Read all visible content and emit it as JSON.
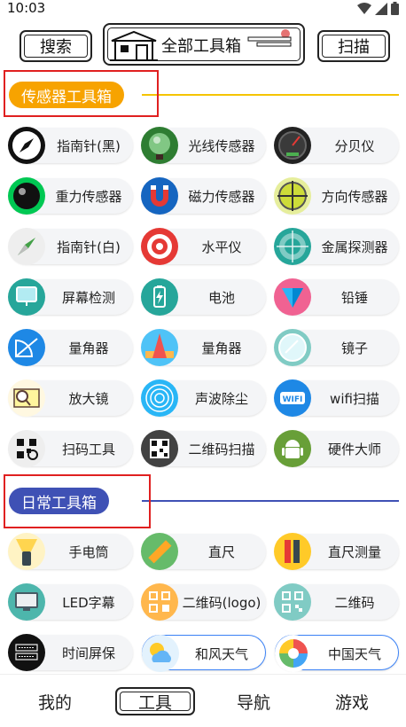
{
  "status_bar": {
    "time": "10:03"
  },
  "header": {
    "search_label": "搜索",
    "title": "全部工具箱",
    "scan_label": "扫描"
  },
  "sections": {
    "sensor": {
      "title": "传感器工具箱",
      "color": "#f7a300",
      "line_color": "#f5c400",
      "items": [
        {
          "label": "指南针(黑)",
          "icon": "compass-black-icon"
        },
        {
          "label": "光线传感器",
          "icon": "light-sensor-icon"
        },
        {
          "label": "分贝仪",
          "icon": "decibel-meter-icon"
        },
        {
          "label": "重力传感器",
          "icon": "gravity-sensor-icon"
        },
        {
          "label": "磁力传感器",
          "icon": "magnet-icon"
        },
        {
          "label": "方向传感器",
          "icon": "direction-sensor-icon"
        },
        {
          "label": "指南针(白)",
          "icon": "compass-white-icon"
        },
        {
          "label": "水平仪",
          "icon": "level-icon"
        },
        {
          "label": "金属探测器",
          "icon": "metal-detector-icon"
        },
        {
          "label": "屏幕检测",
          "icon": "screen-test-icon"
        },
        {
          "label": "电池",
          "icon": "battery-icon"
        },
        {
          "label": "铅锤",
          "icon": "plumb-bob-icon"
        },
        {
          "label": "量角器",
          "icon": "protractor-icon"
        },
        {
          "label": "量角器",
          "icon": "protractor-ruler-icon"
        },
        {
          "label": "镜子",
          "icon": "mirror-icon"
        },
        {
          "label": "放大镜",
          "icon": "magnifier-icon"
        },
        {
          "label": "声波除尘",
          "icon": "sound-wave-icon"
        },
        {
          "label": "wifi扫描",
          "icon": "wifi-icon"
        },
        {
          "label": "扫码工具",
          "icon": "scan-code-icon"
        },
        {
          "label": "二维码扫描",
          "icon": "qr-scan-icon"
        },
        {
          "label": "硬件大师",
          "icon": "android-icon"
        }
      ]
    },
    "daily": {
      "title": "日常工具箱",
      "color": "#3f51b5",
      "line_color": "#3f51b5",
      "items": [
        {
          "label": "手电筒",
          "icon": "flashlight-icon"
        },
        {
          "label": "直尺",
          "icon": "ruler-icon"
        },
        {
          "label": "直尺测量",
          "icon": "ruler-measure-icon"
        },
        {
          "label": "LED字幕",
          "icon": "led-monitor-icon"
        },
        {
          "label": "二维码(logo)",
          "icon": "qr-logo-icon"
        },
        {
          "label": "二维码",
          "icon": "qr-code-icon"
        },
        {
          "label": "时间屏保",
          "icon": "clock-screen-icon"
        },
        {
          "label": "和风天气",
          "icon": "weather-icon"
        },
        {
          "label": "中国天气",
          "icon": "china-weather-icon"
        }
      ]
    }
  },
  "bottom_nav": {
    "items": [
      "我的",
      "工具",
      "导航",
      "游戏"
    ],
    "active_index": 1
  }
}
